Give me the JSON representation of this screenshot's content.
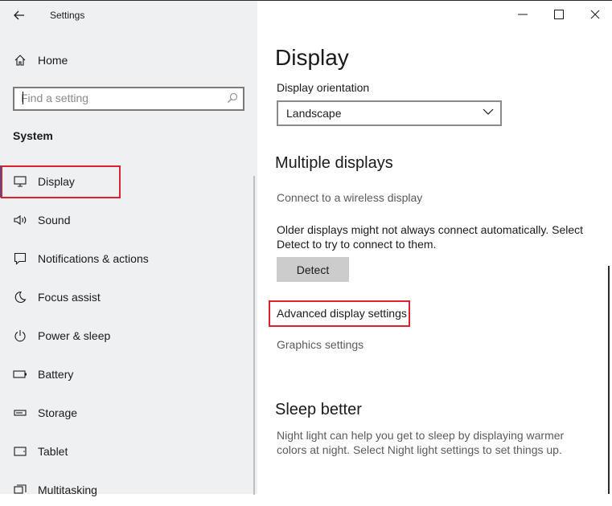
{
  "window": {
    "title": "Settings",
    "controls": {
      "minimize": "minimize",
      "maximize": "maximize",
      "close": "close"
    }
  },
  "sidebar": {
    "home_label": "Home",
    "search": {
      "placeholder": "Find a setting",
      "value": ""
    },
    "section_label": "System",
    "items": [
      {
        "label": "Display",
        "icon": "monitor-icon",
        "active": true
      },
      {
        "label": "Sound",
        "icon": "speaker-icon"
      },
      {
        "label": "Notifications & actions",
        "icon": "notification-icon"
      },
      {
        "label": "Focus assist",
        "icon": "moon-icon"
      },
      {
        "label": "Power & sleep",
        "icon": "power-icon"
      },
      {
        "label": "Battery",
        "icon": "battery-icon"
      },
      {
        "label": "Storage",
        "icon": "storage-icon"
      },
      {
        "label": "Tablet",
        "icon": "tablet-icon"
      },
      {
        "label": "Multitasking",
        "icon": "multitasking-icon"
      }
    ]
  },
  "content": {
    "title": "Display",
    "orientation": {
      "label": "Display orientation",
      "selected": "Landscape"
    },
    "multiple_displays": {
      "heading": "Multiple displays",
      "wireless_link": "Connect to a wireless display",
      "description": "Older displays might not always connect automatically. Select Detect to try to connect to them.",
      "detect_label": "Detect",
      "advanced_link": "Advanced display settings",
      "graphics_link": "Graphics settings"
    },
    "sleep_better": {
      "heading": "Sleep better",
      "description": "Night light can help you get to sleep by displaying warmer colors at night. Select Night light settings to set things up."
    }
  },
  "colors": {
    "sidebar_bg": "#eef0f2",
    "highlight": "#e0202a",
    "accent": "#0067c0",
    "button_bg": "#cccccc"
  }
}
